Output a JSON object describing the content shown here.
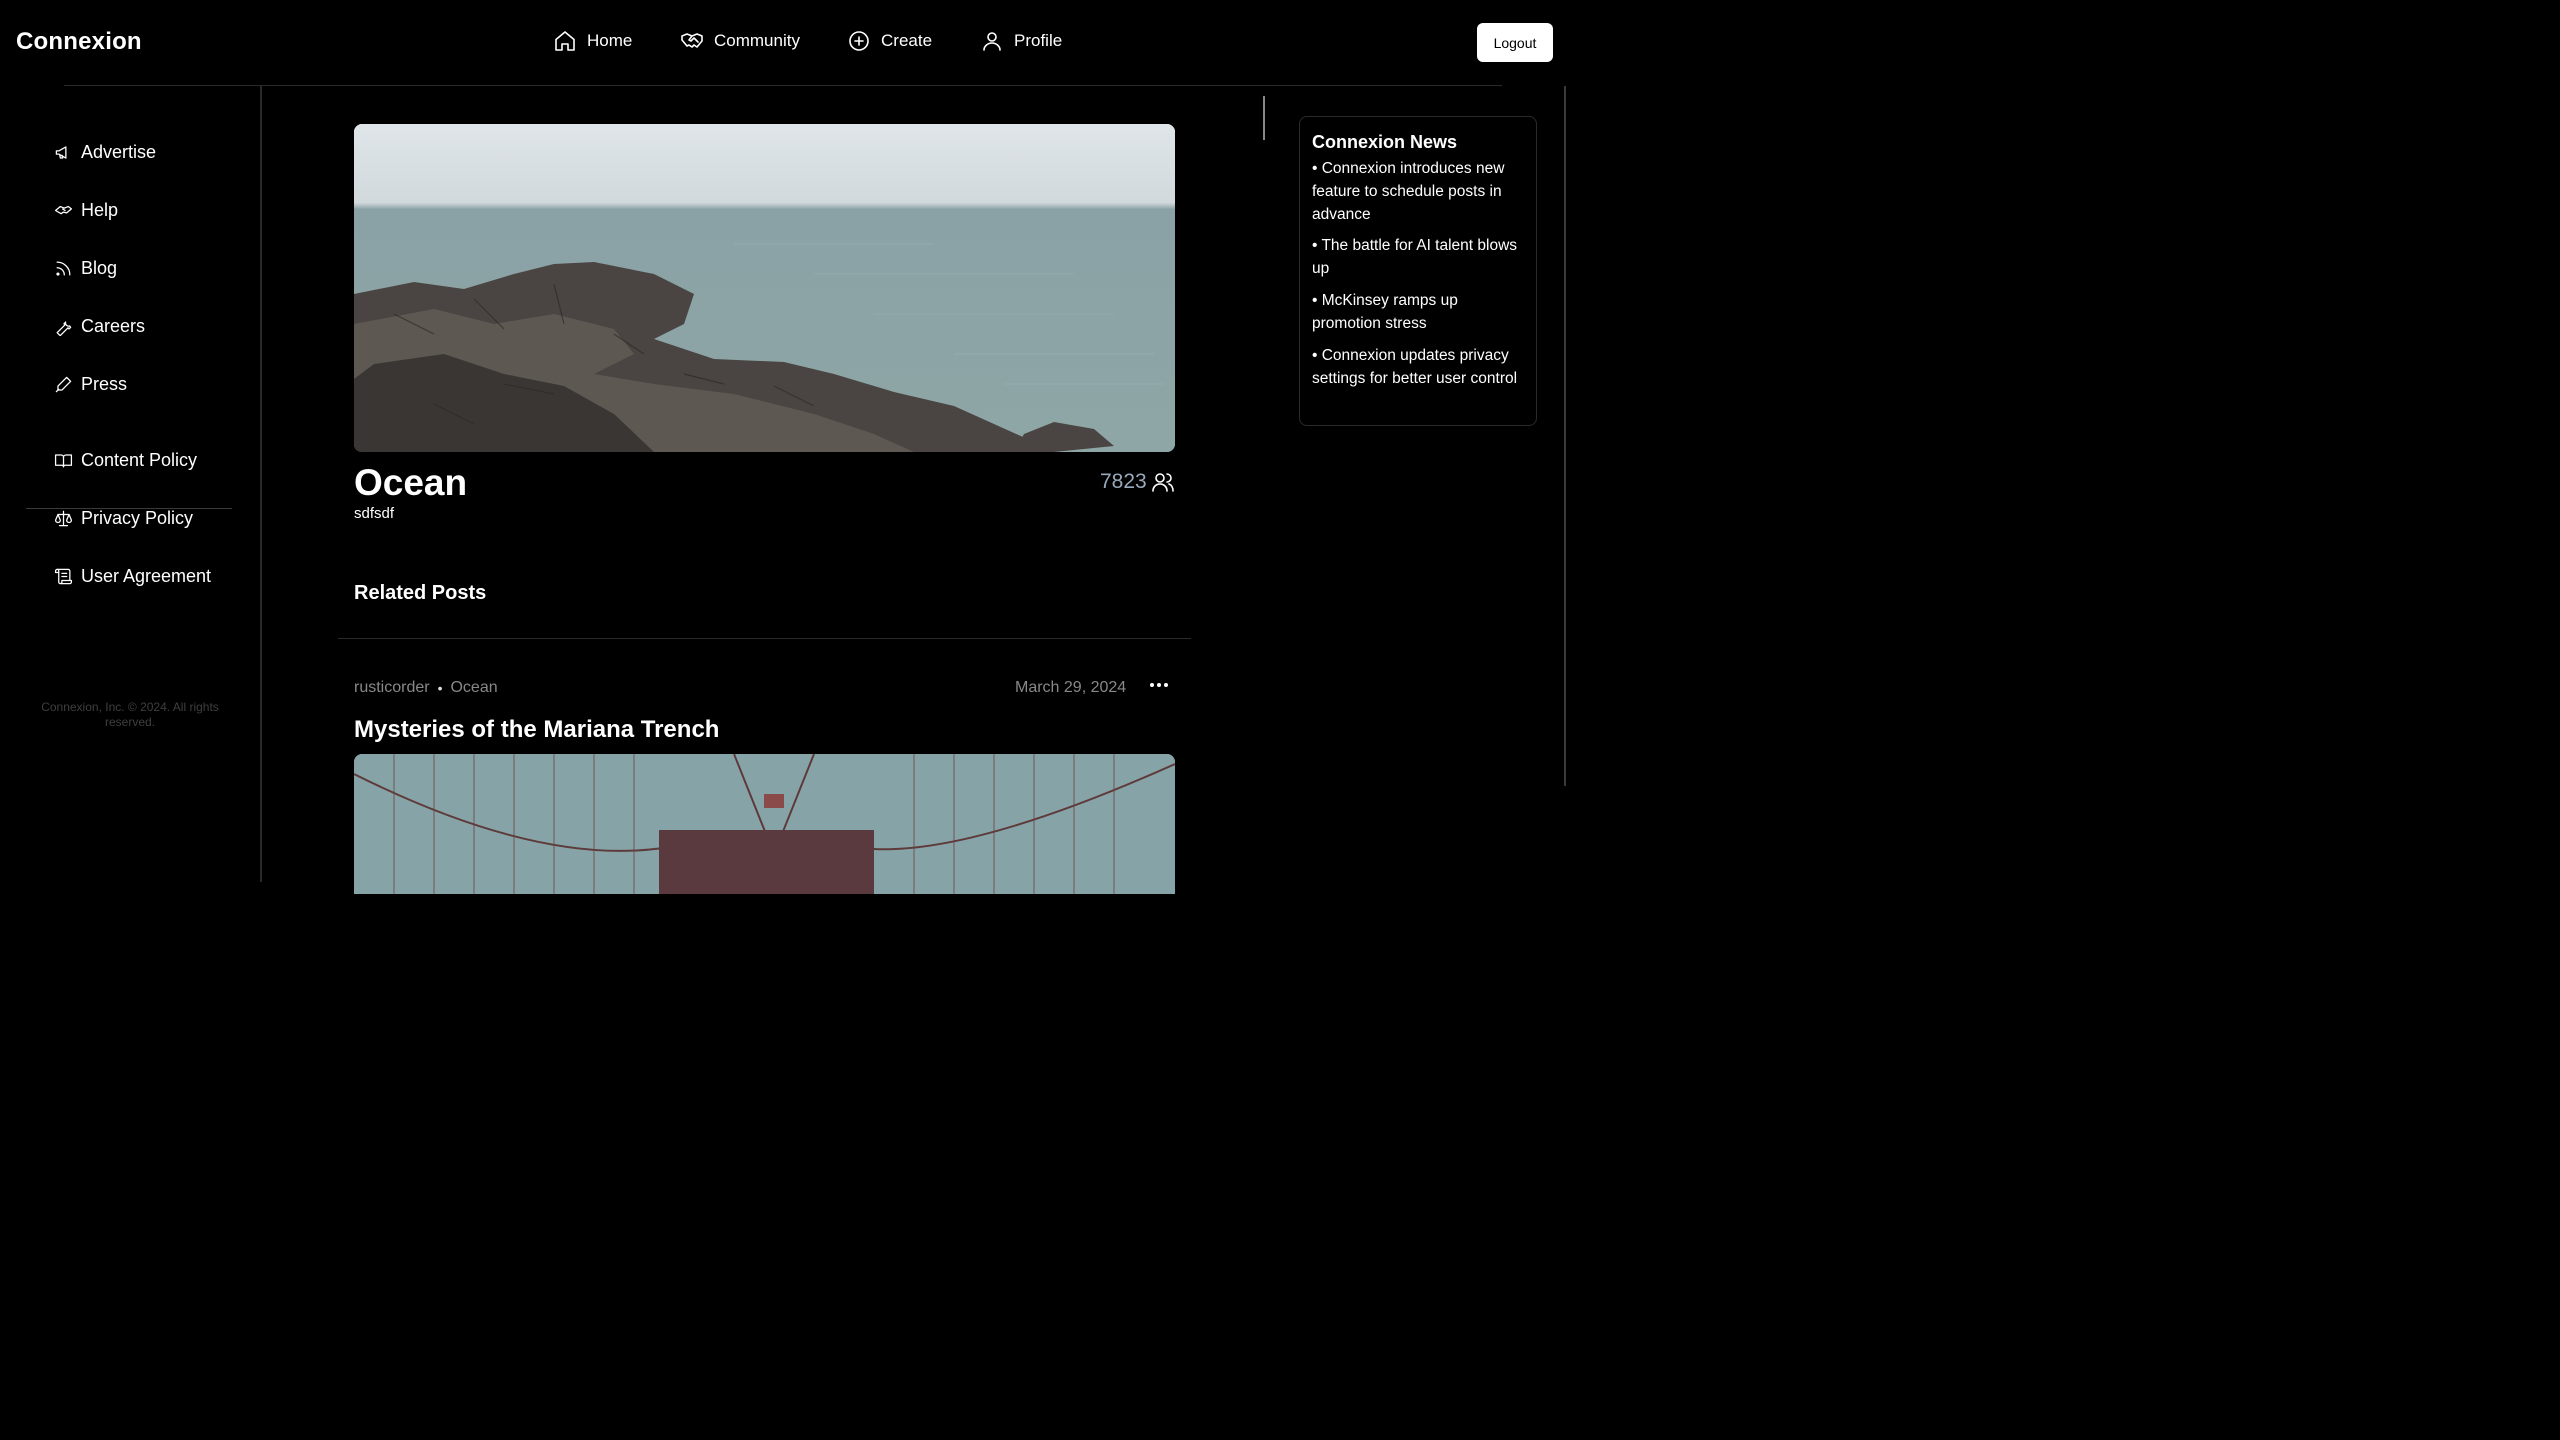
{
  "brand": "Connexion",
  "nav": {
    "home": "Home",
    "community": "Community",
    "create": "Create",
    "profile": "Profile",
    "logout": "Logout"
  },
  "sidebar": {
    "items": [
      {
        "label": "Advertise",
        "icon": "megaphone-icon"
      },
      {
        "label": "Help",
        "icon": "handshake-icon"
      },
      {
        "label": "Blog",
        "icon": "rss-icon"
      },
      {
        "label": "Careers",
        "icon": "wrench-icon"
      },
      {
        "label": "Press",
        "icon": "pen-icon"
      }
    ],
    "policy_items": [
      {
        "label": "Content Policy",
        "icon": "book-icon"
      },
      {
        "label": "Privacy Policy",
        "icon": "scale-icon"
      },
      {
        "label": "User Agreement",
        "icon": "scroll-icon"
      }
    ],
    "copyright": "Connexion, Inc. © 2024. All rights reserved."
  },
  "community": {
    "title": "Ocean",
    "description": "sdfsdf",
    "member_count": "7823"
  },
  "related_heading": "Related Posts",
  "post": {
    "author": "rusticorder",
    "community": "Ocean",
    "date": "March 29, 2024",
    "title": "Mysteries of the Mariana Trench"
  },
  "news": {
    "title": "Connexion News",
    "items": [
      "Connexion introduces new feature to schedule posts in advance",
      "The battle for AI talent blows up",
      "McKinsey ramps up promotion stress",
      "Connexion updates privacy settings for better user control"
    ]
  }
}
